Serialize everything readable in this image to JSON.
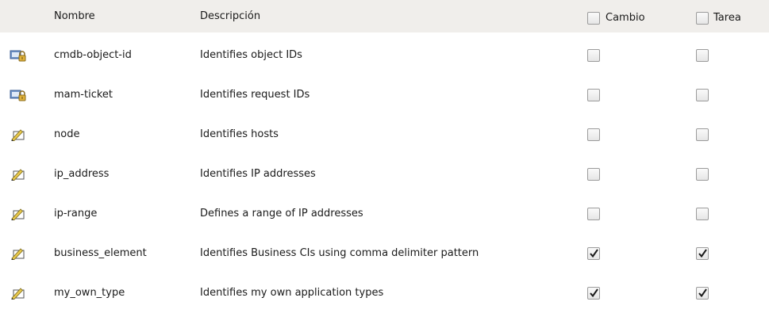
{
  "table": {
    "headers": {
      "name": "Nombre",
      "description": "Descripción",
      "change": "Cambio",
      "task": "Tarea"
    },
    "rows": [
      {
        "icon": "locked-type-icon",
        "name": "cmdb-object-id",
        "description": "Identifies object IDs",
        "change": false,
        "task": false
      },
      {
        "icon": "locked-type-icon",
        "name": "mam-ticket",
        "description": "Identifies request IDs",
        "change": false,
        "task": false
      },
      {
        "icon": "editable-type-icon",
        "name": "node",
        "description": "Identifies hosts",
        "change": false,
        "task": false
      },
      {
        "icon": "editable-type-icon",
        "name": "ip_address",
        "description": "Identifies IP addresses",
        "change": false,
        "task": false
      },
      {
        "icon": "editable-type-icon",
        "name": "ip-range",
        "description": "Defines a range of IP addresses",
        "change": false,
        "task": false
      },
      {
        "icon": "editable-type-icon",
        "name": "business_element",
        "description": "Identifies Business CIs using comma delimiter pattern",
        "change": true,
        "task": true
      },
      {
        "icon": "editable-type-icon",
        "name": "my_own_type",
        "description": "Identifies my own application types",
        "change": true,
        "task": true
      }
    ]
  }
}
